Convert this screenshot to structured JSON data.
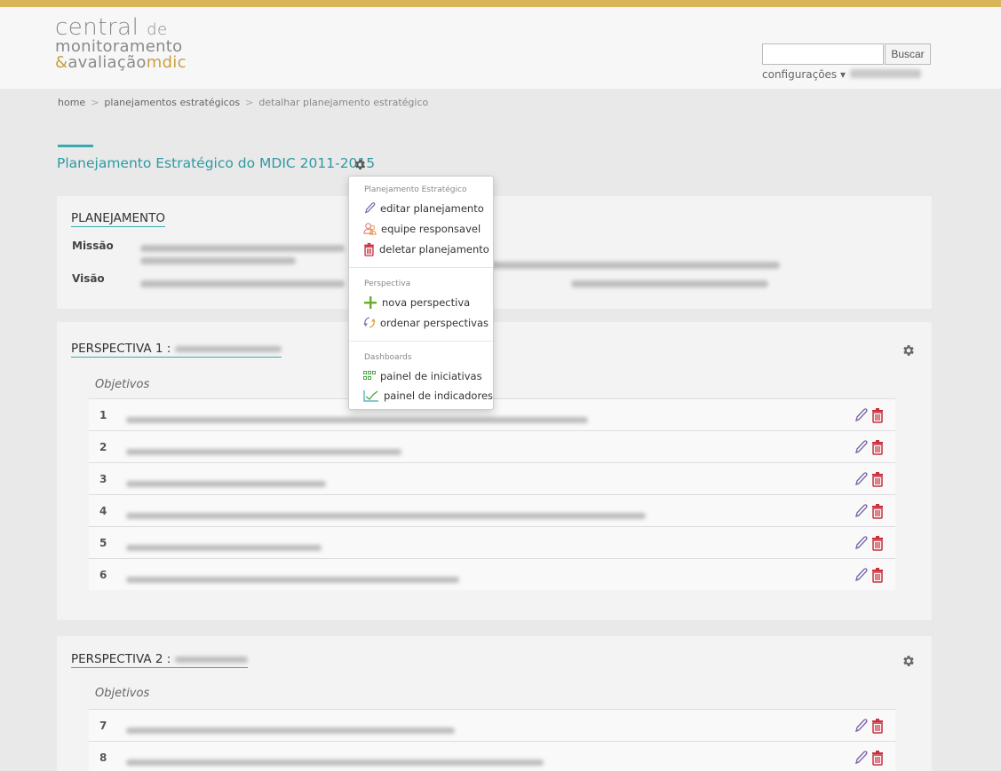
{
  "header": {
    "logo": {
      "line1": "central",
      "line1_suffix": "de",
      "line2": "monitoramento",
      "line3_amp": "&",
      "line3": "avaliação",
      "line3_brand": "mdic"
    },
    "search": {
      "placeholder": "",
      "button_label": "Buscar"
    },
    "config_label": "configurações ▾"
  },
  "breadcrumb": {
    "home": "home",
    "level2": "planejamentos estratégicos",
    "current": "detalhar planejamento estratégico",
    "separator": ">"
  },
  "page_title": "Planejamento Estratégico do MDIC 2011-2015",
  "planejamento": {
    "heading": "PLANEJAMENTO",
    "missao_label": "Missão",
    "visao_label": "Visão"
  },
  "perspectivas": [
    {
      "heading": "PERSPECTIVA 1 :",
      "objetivos_label": "Objetivos",
      "rows": [
        "1",
        "2",
        "3",
        "4",
        "5",
        "6"
      ]
    },
    {
      "heading": "PERSPECTIVA 2 :",
      "objetivos_label": "Objetivos",
      "rows": [
        "7",
        "8"
      ]
    }
  ],
  "dropdown": {
    "section1": "Planejamento Estratégico",
    "editar": "editar planejamento",
    "equipe": "equipe responsavel",
    "deletar": "deletar planejamento",
    "section2": "Perspectiva",
    "nova": "nova perspectiva",
    "ordenar": "ordenar perspectivas",
    "section3": "Dashboards",
    "iniciativas": "painel de iniciativas",
    "indicadores": "painel de indicadores"
  },
  "colors": {
    "accent": "#3aa9b0",
    "brand": "#c8a042",
    "delete": "#c9303c",
    "edit": "#7a5fa8",
    "add": "#6aab2e"
  }
}
